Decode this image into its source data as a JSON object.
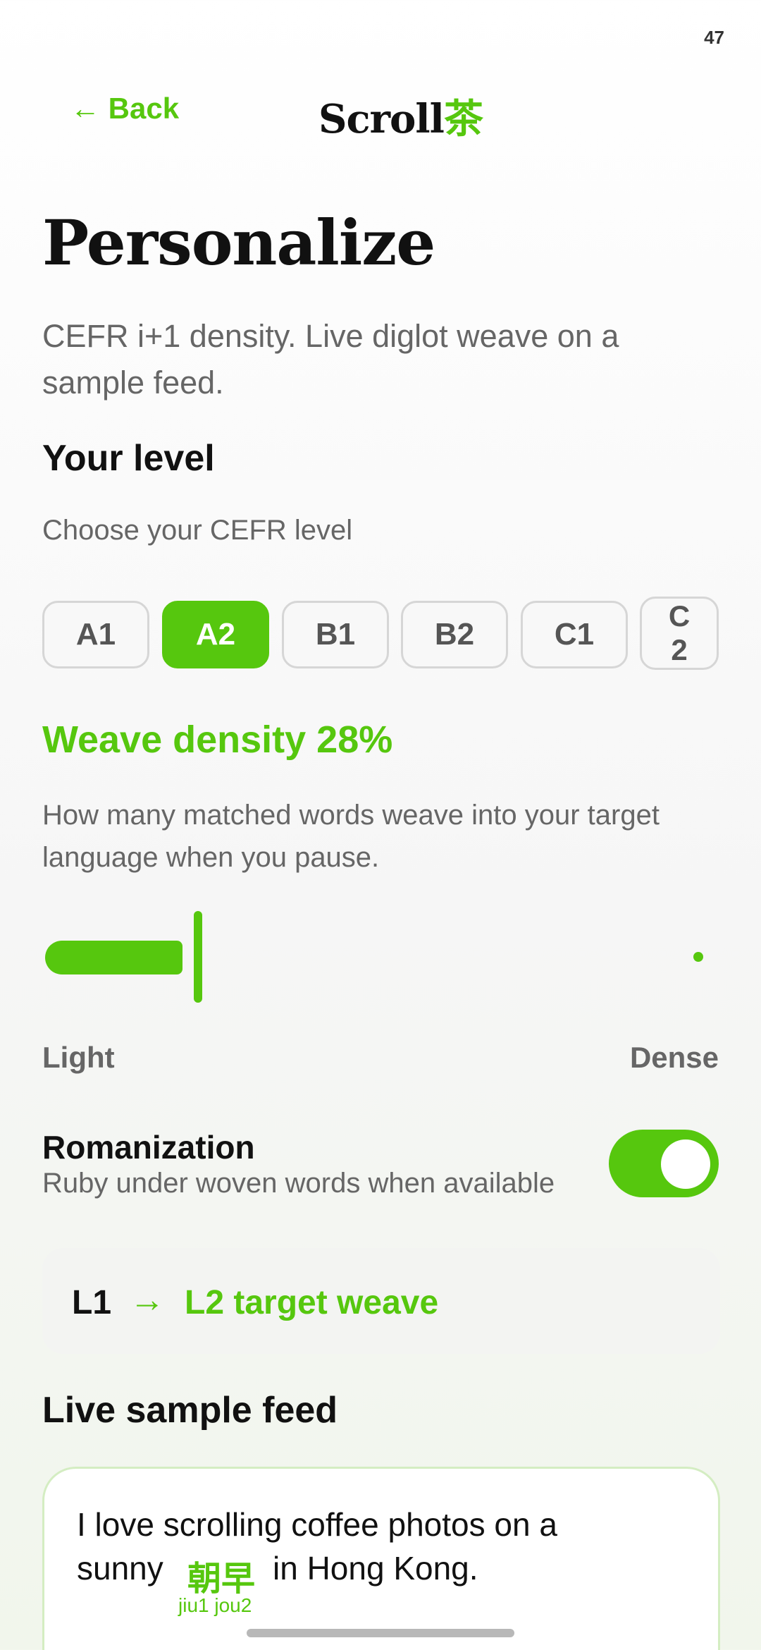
{
  "status": {
    "time": "47"
  },
  "header": {
    "back_label": "← Back",
    "brand_main": "Scroll",
    "brand_accent": "茶"
  },
  "page": {
    "title": "Personalize",
    "subtitle": "CEFR i+1 density. Live diglot weave on a sample feed."
  },
  "level": {
    "heading": "Your level",
    "prompt": "Choose your CEFR level",
    "options": [
      "A1",
      "A2",
      "B1",
      "B2",
      "C1",
      "C2"
    ],
    "selected": "A2"
  },
  "density": {
    "heading": "Weave density 28%",
    "value_percent": 28,
    "description": "How many matched words weave into your target language when you pause.",
    "min_label": "Light",
    "max_label": "Dense"
  },
  "romanization": {
    "title": "Romanization",
    "subtitle": "Ruby under woven words when available",
    "enabled": true
  },
  "weave": {
    "l1": "L1",
    "arrow": "→",
    "l2": "L2 target weave"
  },
  "feed": {
    "heading": "Live sample feed",
    "line1": "I love scrolling coffee photos on a",
    "line2_start": "sunny",
    "woven_word": "朝早",
    "line2_end": "in Hong Kong.",
    "ruby": "jiu1 jou2"
  },
  "colors": {
    "accent": "#56c70e",
    "text": "#111111",
    "muted": "#666666"
  }
}
